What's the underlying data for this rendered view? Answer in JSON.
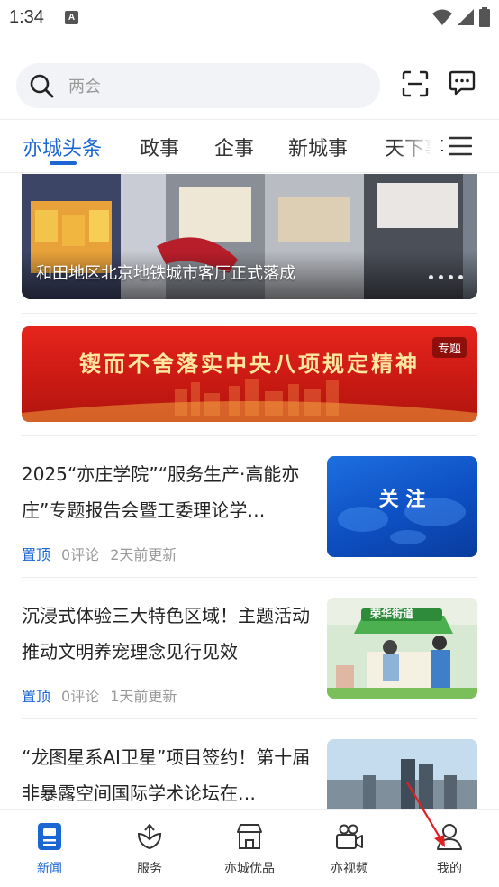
{
  "status_bar": {
    "time": "1:34",
    "notification_letter": "A"
  },
  "search": {
    "placeholder": "两会"
  },
  "tabs": [
    {
      "label": "亦城头条",
      "active": true
    },
    {
      "label": "政事",
      "active": false
    },
    {
      "label": "企事",
      "active": false
    },
    {
      "label": "新城事",
      "active": false
    },
    {
      "label": "天下事",
      "active": false
    }
  ],
  "banner": {
    "caption": "和田地区北京地铁城市客厅正式落成"
  },
  "special_banner": {
    "title": "锲而不舍落实中央八项规定精神",
    "tag": "专题"
  },
  "news": [
    {
      "title": "2025“亦庄学院”“服务生产·高能亦庄”专题报告会暨工委理论学…",
      "pin": "置顶",
      "comments": "0评论",
      "updated": "2天前更新",
      "thumb_text": "关 注"
    },
    {
      "title": "沉浸式体验三大特色区域！主题活动推动文明养宠理念见行见效",
      "pin": "置顶",
      "comments": "0评论",
      "updated": "1天前更新",
      "thumb_text": "荣华街道"
    },
    {
      "title": "“龙图星系AI卫星”项目签约！第十届非暴露空间国际学术论坛在…",
      "pin": "",
      "comments": "",
      "updated": ""
    }
  ],
  "bottom_nav": [
    {
      "label": "新闻",
      "icon": "news-icon",
      "active": true
    },
    {
      "label": "服务",
      "icon": "service-icon",
      "active": false
    },
    {
      "label": "亦城优品",
      "icon": "shop-icon",
      "active": false
    },
    {
      "label": "亦视频",
      "icon": "video-icon",
      "active": false
    },
    {
      "label": "我的",
      "icon": "profile-icon",
      "active": false
    }
  ],
  "colors": {
    "accent": "#1a66d2",
    "special_red": "#d8221a",
    "text": "#222222",
    "muted": "#999999"
  }
}
